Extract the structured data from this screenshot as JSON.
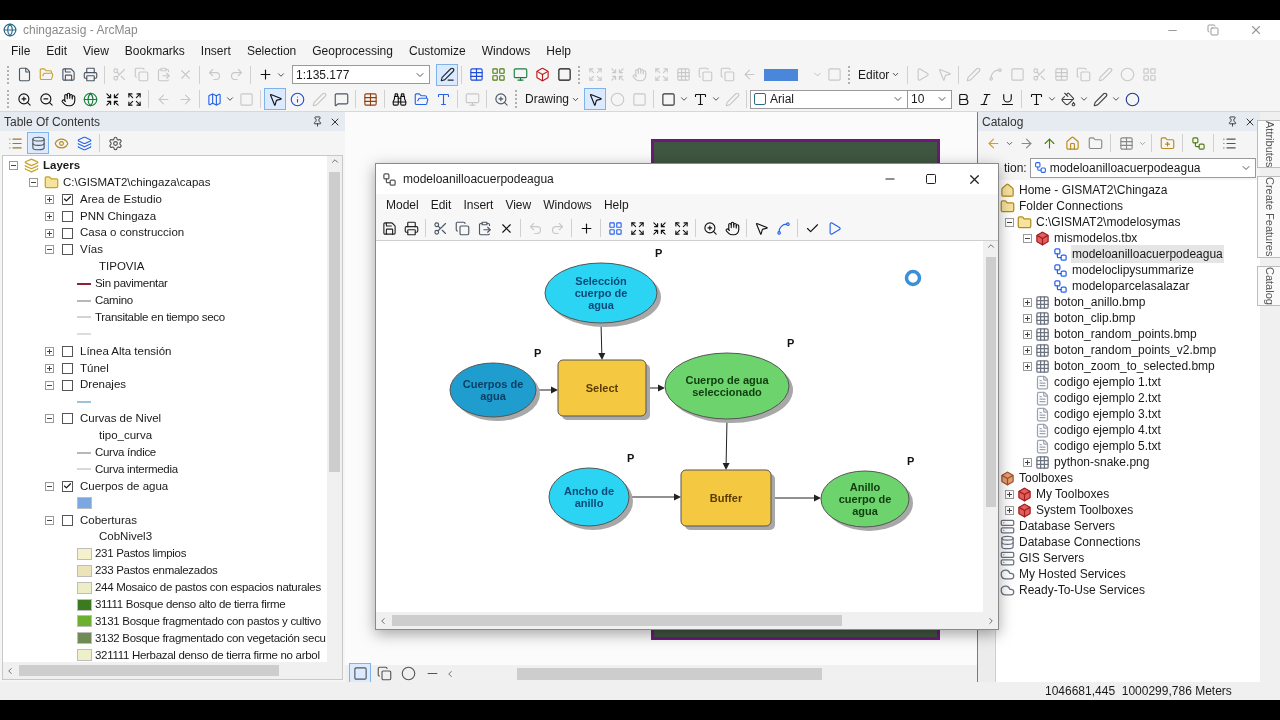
{
  "window": {
    "title": "chingazasig - ArcMap"
  },
  "menu": [
    "File",
    "Edit",
    "View",
    "Bookmarks",
    "Insert",
    "Selection",
    "Geoprocessing",
    "Customize",
    "Windows",
    "Help"
  ],
  "standard_toolbar": {
    "scale": "1:135.177",
    "editor": "Editor"
  },
  "tools_toolbar": {
    "drawing": "Drawing",
    "font": "Arial",
    "font_size": "10"
  },
  "toc": {
    "title": "Table Of Contents",
    "tree": [
      {
        "kind": "group",
        "label": "Layers",
        "expanded": true,
        "children": [
          {
            "kind": "folder",
            "label": "C:\\GISMAT2\\chingaza\\capas",
            "expanded": true,
            "children": [
              {
                "kind": "layer",
                "label": "Area de Estudio",
                "checked": true,
                "expanded": false
              },
              {
                "kind": "layer",
                "label": "PNN Chingaza",
                "checked": false,
                "expanded": false
              },
              {
                "kind": "layer",
                "label": "Casa o construccion",
                "checked": false,
                "expanded": false
              },
              {
                "kind": "layer",
                "label": "Vías",
                "checked": false,
                "expanded": true,
                "children": [
                  {
                    "kind": "field",
                    "label": "TIPOVIA"
                  },
                  {
                    "kind": "line",
                    "label": "Sin pavimentar",
                    "color": "#8b2332"
                  },
                  {
                    "kind": "line",
                    "label": "Camino",
                    "color": "#b8b8b8"
                  },
                  {
                    "kind": "line",
                    "label": "Transitable en tiempo seco",
                    "color": "#d4d4d4"
                  },
                  {
                    "kind": "line",
                    "color": "#dcdcdc"
                  }
                ]
              },
              {
                "kind": "layer",
                "label": "Línea Alta tensión",
                "checked": false,
                "expanded": false
              },
              {
                "kind": "layer",
                "label": "Túnel",
                "checked": false,
                "expanded": false
              },
              {
                "kind": "layer",
                "label": "Drenajes",
                "checked": false,
                "expanded": true,
                "children": [
                  {
                    "kind": "line",
                    "color": "#9cc3d8"
                  }
                ]
              },
              {
                "kind": "layer",
                "label": "Curvas de Nivel",
                "checked": false,
                "expanded": true,
                "children": [
                  {
                    "kind": "field",
                    "label": "tipo_curva"
                  },
                  {
                    "kind": "line",
                    "label": "Curva índice",
                    "color": "#b8b8b8"
                  },
                  {
                    "kind": "line",
                    "label": "Curva intermedia",
                    "color": "#d8d8d8"
                  }
                ]
              },
              {
                "kind": "layer",
                "label": "Cuerpos de agua",
                "checked": true,
                "expanded": true,
                "children": [
                  {
                    "kind": "fill",
                    "color": "#7ba7e2"
                  }
                ]
              },
              {
                "kind": "layer",
                "label": "Coberturas",
                "checked": false,
                "expanded": true,
                "children": [
                  {
                    "kind": "field",
                    "label": "CobNivel3"
                  },
                  {
                    "kind": "fill",
                    "label": "231 Pastos limpios",
                    "color": "#f4f1cc"
                  },
                  {
                    "kind": "fill",
                    "label": "233 Pastos enmalezados",
                    "color": "#ede3b8"
                  },
                  {
                    "kind": "fill",
                    "label": "244 Mosaico de pastos con espacios naturales",
                    "color": "#eeeec6"
                  },
                  {
                    "kind": "fill",
                    "label": "31111 Bosque denso alto de tierra firme",
                    "color": "#3b7a1f"
                  },
                  {
                    "kind": "fill",
                    "label": "3131 Bosque fragmentado con pastos y cultivo",
                    "color": "#6cb030"
                  },
                  {
                    "kind": "fill",
                    "label": "3132 Bosque fragmentado con vegetación secu",
                    "color": "#6f8a52"
                  },
                  {
                    "kind": "fill",
                    "label": "321111 Herbazal denso de tierra firme no arbol",
                    "color": "#eef0c8"
                  }
                ]
              }
            ]
          }
        ]
      }
    ]
  },
  "model_window": {
    "title": "modeloanilloacuerpodeagua",
    "menu": [
      "Model",
      "Edit",
      "Insert",
      "View",
      "Windows",
      "Help"
    ],
    "nodes": [
      {
        "kind": "value",
        "label": "Selección\ncuerpo de\nagua",
        "parameter": "P"
      },
      {
        "kind": "input",
        "label": "Cuerpos de\nagua",
        "parameter": "P"
      },
      {
        "kind": "tool",
        "label": "Select"
      },
      {
        "kind": "output",
        "label": "Cuerpo de agua\nseleccionado",
        "parameter": "P"
      },
      {
        "kind": "value",
        "label": "Ancho de\nanillo",
        "parameter": "P"
      },
      {
        "kind": "tool",
        "label": "Buffer"
      },
      {
        "kind": "output",
        "label": "Anillo\ncuerpo de\nagua",
        "parameter": "P"
      }
    ]
  },
  "catalog": {
    "title": "Catalog",
    "location_label": "tion:",
    "location": "modeloanilloacuerpodeagua",
    "tree": [
      {
        "kind": "home",
        "label": "Home - GISMAT2\\Chingaza"
      },
      {
        "kind": "folder-connections",
        "label": "Folder Connections",
        "children": [
          {
            "kind": "folder",
            "label": "C:\\GISMAT2\\modelosymas",
            "expanded": true,
            "children": [
              {
                "kind": "toolbox",
                "label": "mismodelos.tbx",
                "expanded": true,
                "children": [
                  {
                    "kind": "model",
                    "label": "modeloanilloacuerpodeagua",
                    "selected": true
                  },
                  {
                    "kind": "model",
                    "label": "modeloclipysummarize",
                    "selected": false
                  },
                  {
                    "kind": "model",
                    "label": "modeloparcelasalazar",
                    "selected": false
                  }
                ]
              },
              {
                "kind": "raster",
                "label": "boton_anillo.bmp",
                "expanded": false
              },
              {
                "kind": "raster",
                "label": "boton_clip.bmp",
                "expanded": false
              },
              {
                "kind": "raster",
                "label": "boton_random_points.bmp",
                "expanded": false
              },
              {
                "kind": "raster",
                "label": "boton_random_points_v2.bmp",
                "expanded": false
              },
              {
                "kind": "raster",
                "label": "boton_zoom_to_selected.bmp",
                "expanded": false
              },
              {
                "kind": "text",
                "label": "codigo ejemplo 1.txt"
              },
              {
                "kind": "text",
                "label": "codigo ejemplo 2.txt"
              },
              {
                "kind": "text",
                "label": "codigo ejemplo 3.txt"
              },
              {
                "kind": "text",
                "label": "codigo ejemplo 4.txt"
              },
              {
                "kind": "text",
                "label": "codigo ejemplo 5.txt"
              },
              {
                "kind": "raster",
                "label": "python-snake.png",
                "expanded": false
              }
            ]
          }
        ]
      },
      {
        "kind": "toolboxes",
        "label": "Toolboxes",
        "children": [
          {
            "kind": "toolbox",
            "label": "My Toolboxes",
            "expanded": false
          },
          {
            "kind": "toolbox",
            "label": "System Toolboxes",
            "expanded": false
          }
        ]
      },
      {
        "kind": "server",
        "label": "Database Servers"
      },
      {
        "kind": "database",
        "label": "Database Connections"
      },
      {
        "kind": "server",
        "label": "GIS Servers"
      },
      {
        "kind": "cloud",
        "label": "My Hosted Services"
      },
      {
        "kind": "cloud",
        "label": "Ready-To-Use Services"
      }
    ]
  },
  "side_tabs": [
    "Attributes",
    "Create Features",
    "Catalog"
  ],
  "status_bar": {
    "coordinates": "1046681,445  1000299,786 Meters"
  }
}
